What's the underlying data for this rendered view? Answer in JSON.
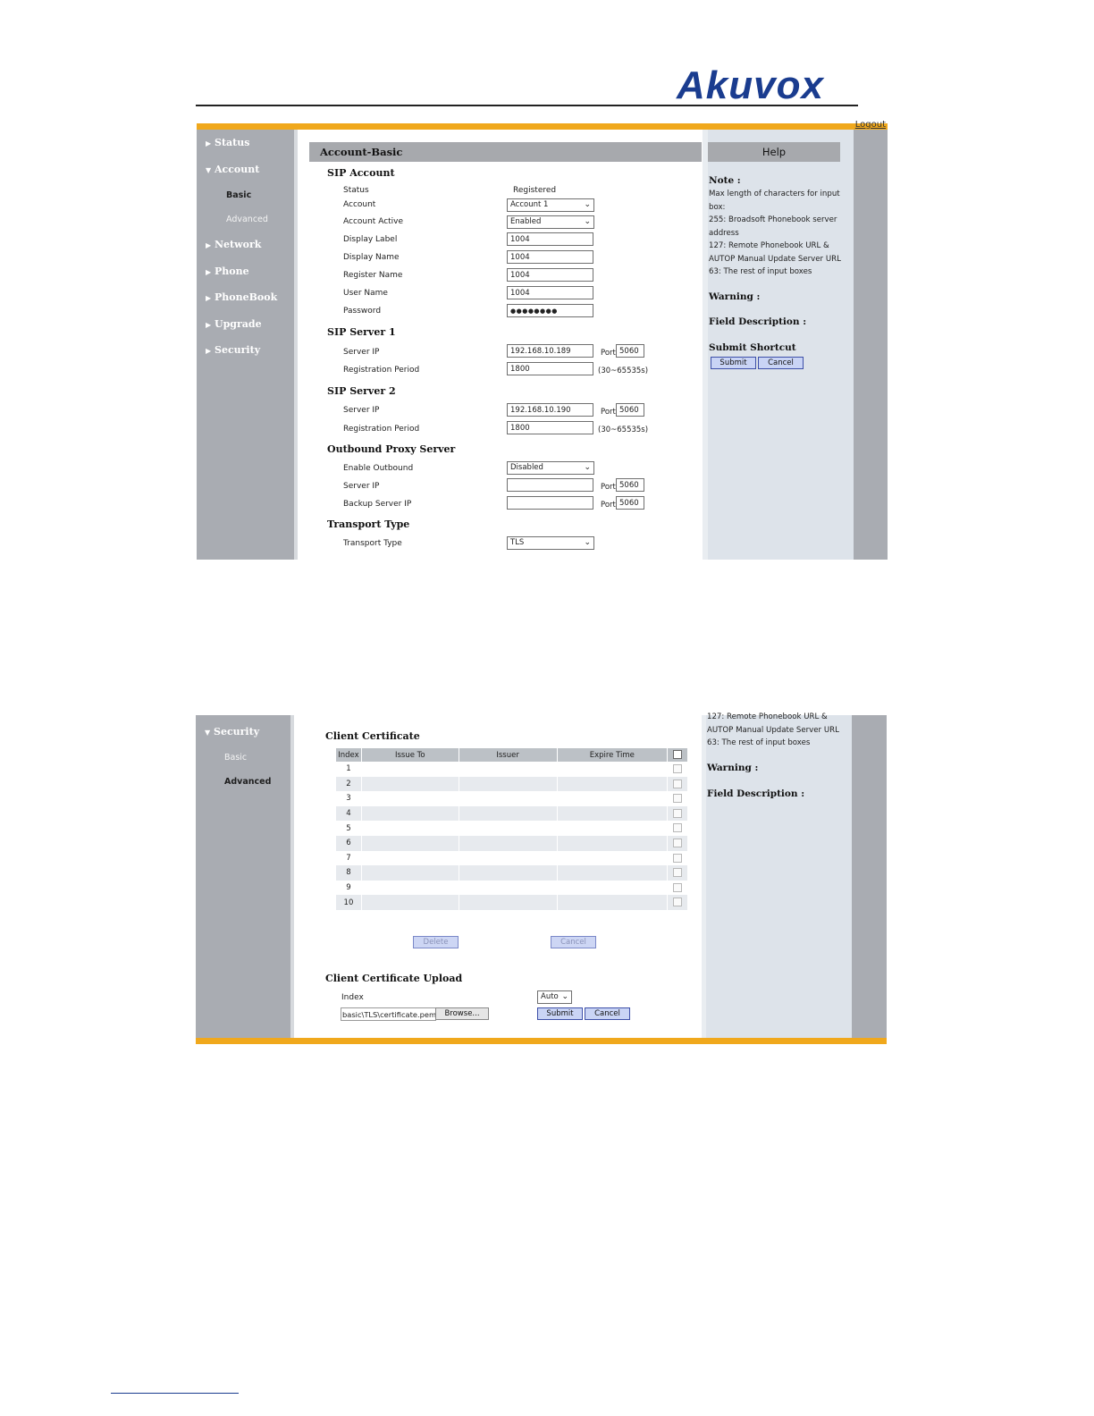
{
  "brand": {
    "logo_text": "Akuvox",
    "brand_color": "#1a3c8f",
    "accent_bar_color": "#f0a81c"
  },
  "screen1": {
    "logout_label": "Logout",
    "nav": {
      "items": [
        {
          "label": "Status",
          "expanded": false
        },
        {
          "label": "Account",
          "expanded": true
        },
        {
          "label": "Network",
          "expanded": false
        },
        {
          "label": "Phone",
          "expanded": false
        },
        {
          "label": "PhoneBook",
          "expanded": false
        },
        {
          "label": "Upgrade",
          "expanded": false
        },
        {
          "label": "Security",
          "expanded": false
        }
      ],
      "account_sub": [
        {
          "label": "Basic",
          "active": true
        },
        {
          "label": "Advanced",
          "active": false
        }
      ]
    },
    "title": "Account-Basic",
    "sip_account": {
      "heading": "SIP Account",
      "status_label": "Status",
      "status_value": "Registered",
      "account_label": "Account",
      "account_value": "Account 1",
      "active_label": "Account Active",
      "active_value": "Enabled",
      "display_label_label": "Display Label",
      "display_label_value": "1004",
      "display_name_label": "Display Name",
      "display_name_value": "1004",
      "register_name_label": "Register Name",
      "register_name_value": "1004",
      "user_name_label": "User Name",
      "user_name_value": "1004",
      "password_label": "Password",
      "password_value": "●●●●●●●●"
    },
    "sip_server1": {
      "heading": "SIP Server 1",
      "server_ip_label": "Server IP",
      "server_ip_value": "192.168.10.189",
      "port_label": "Port",
      "port_value": "5060",
      "reg_period_label": "Registration Period",
      "reg_period_value": "1800",
      "reg_period_range": "(30~65535s)"
    },
    "sip_server2": {
      "heading": "SIP Server 2",
      "server_ip_label": "Server IP",
      "server_ip_value": "192.168.10.190",
      "port_label": "Port",
      "port_value": "5060",
      "reg_period_label": "Registration Period",
      "reg_period_value": "1800",
      "reg_period_range": "(30~65535s)"
    },
    "outbound": {
      "heading": "Outbound Proxy Server",
      "enable_label": "Enable Outbound",
      "enable_value": "Disabled",
      "server_ip_label": "Server IP",
      "server_ip_value": "",
      "port_label": "Port",
      "port_value": "5060",
      "backup_label": "Backup Server IP",
      "backup_value": "",
      "backup_port_label": "Port",
      "backup_port_value": "5060"
    },
    "transport": {
      "heading": "Transport Type",
      "label": "Transport Type",
      "value": "TLS"
    },
    "help": {
      "title": "Help",
      "note_heading": "Note :",
      "note_lines": [
        "Max length of characters for input",
        "box:",
        "255: Broadsoft Phonebook server",
        "address",
        "127: Remote Phonebook URL &",
        "AUTOP Manual Update Server URL",
        "63: The rest of input boxes"
      ],
      "warning_heading": "Warning :",
      "field_desc_heading": "Field Description :",
      "submit_shortcut_heading": "Submit Shortcut",
      "submit_label": "Submit",
      "cancel_label": "Cancel"
    }
  },
  "screen2": {
    "nav": {
      "security_label": "Security",
      "sub": [
        {
          "label": "Basic",
          "active": false
        },
        {
          "label": "Advanced",
          "active": true
        }
      ]
    },
    "help": {
      "lines": [
        "127: Remote Phonebook URL &",
        "AUTOP Manual Update Server URL",
        "63: The rest of input boxes"
      ],
      "warning_heading": "Warning :",
      "field_desc_heading": "Field Description :"
    },
    "client_cert": {
      "heading": "Client Certificate",
      "columns": [
        "Index",
        "Issue To",
        "Issuer",
        "Expire Time"
      ],
      "rows": [
        "1",
        "2",
        "3",
        "4",
        "5",
        "6",
        "7",
        "8",
        "9",
        "10"
      ],
      "delete_label": "Delete",
      "cancel_label": "Cancel"
    },
    "upload": {
      "heading": "Client Certificate Upload",
      "index_label": "Index",
      "index_value": "Auto",
      "file_path": "basic\\TLS\\certificate.pem",
      "browse_label": "Browse...",
      "submit_label": "Submit",
      "cancel_label": "Cancel"
    }
  }
}
